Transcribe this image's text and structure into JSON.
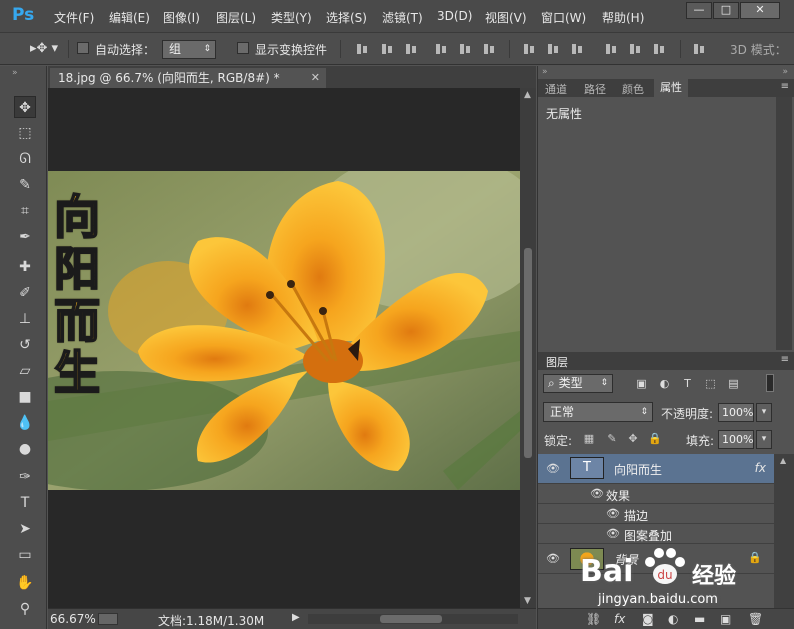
{
  "app": {
    "logo": "Ps"
  },
  "menu": [
    "文件(F)",
    "编辑(E)",
    "图像(I)",
    "图层(L)",
    "类型(Y)",
    "选择(S)",
    "滤镜(T)",
    "3D(D)",
    "视图(V)",
    "窗口(W)",
    "帮助(H)"
  ],
  "window_controls": {
    "minimize": "—",
    "restore": "□",
    "close": "✕"
  },
  "options": {
    "auto_select_label": "自动选择：",
    "auto_select_value": "组",
    "show_transform_label": "显示变换控件",
    "mode_label": "3D 模式："
  },
  "document": {
    "tab_title": "18.jpg @ 66.7% (向阳而生, RGB/8#) *",
    "image_text": [
      "向",
      "阳",
      "而",
      "生"
    ]
  },
  "status": {
    "zoom": "66.67%",
    "doc_size": "文档:1.18M/1.30M"
  },
  "properties": {
    "tabs": [
      "通道",
      "路径",
      "颜色",
      "属性"
    ],
    "active_tab": "属性",
    "body_text": "无属性"
  },
  "layers": {
    "title": "图层",
    "filter_label": "类型",
    "blend_mode": "正常",
    "opacity_label": "不透明度:",
    "opacity_value": "100%",
    "lock_label": "锁定:",
    "fill_label": "填充:",
    "fill_value": "100%",
    "items": [
      {
        "name": "向阳而生",
        "thumb": "T",
        "fx": "fx",
        "selected": true
      },
      {
        "name": "效果"
      },
      {
        "name": "描边"
      },
      {
        "name": "图案叠加"
      },
      {
        "name": "背景",
        "locked": true
      }
    ]
  },
  "watermark": {
    "brand": "Bai",
    "brand_tail": "经验",
    "url": "jingyan.baidu.com"
  },
  "colors": {
    "accent": "#36a8ef",
    "panel": "#535353",
    "dark": "#282828",
    "selection": "#5b7391"
  }
}
